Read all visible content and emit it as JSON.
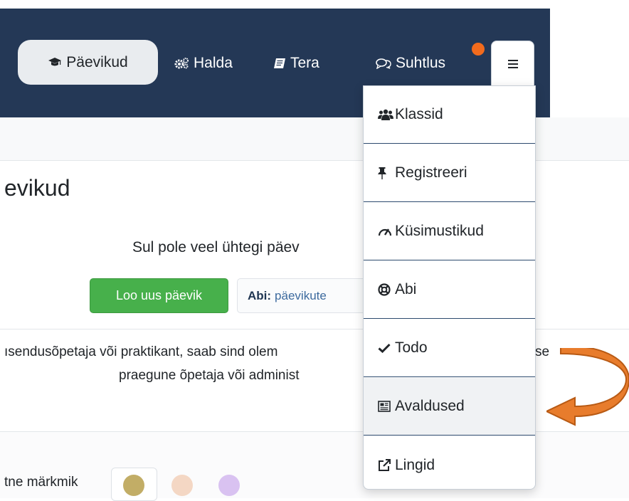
{
  "nav": {
    "items": [
      {
        "label": "Päevikud",
        "icon": "graduation-cap-icon"
      },
      {
        "label": "Halda",
        "icon": "gears-icon"
      },
      {
        "label": "Tera",
        "icon": "book-icon"
      },
      {
        "label": "Suhtlus",
        "icon": "comments-icon"
      }
    ],
    "menu_icon": "hamburger-icon",
    "colors": {
      "navbar": "#243856",
      "notification": "#f26b1d"
    }
  },
  "page": {
    "title": "evikud",
    "empty_message": "Sul pole veel ühtegi päev",
    "create_button": "Loo uus päevik",
    "help_label": "Abi:",
    "help_link": "päevikute",
    "info_line1": "ısendusõpetaja või praktikant, saab sind olem",
    "info_tail": "se",
    "info_line2": "praegune õpetaja või administ",
    "notebook_label": "tne märkmik",
    "swatch_colors": [
      "#c2ad66",
      "#f4d7c4",
      "#d9c2f1"
    ]
  },
  "dropdown": {
    "items": [
      {
        "label": "Klassid",
        "icon": "users-icon"
      },
      {
        "label": "Registreeri",
        "icon": "thumbtack-icon"
      },
      {
        "label": "Küsimustikud",
        "icon": "gauge-icon"
      },
      {
        "label": "Abi",
        "icon": "life-ring-icon"
      },
      {
        "label": "Todo",
        "icon": "check-icon"
      },
      {
        "label": "Avaldused",
        "icon": "newspaper-icon"
      },
      {
        "label": "Lingid",
        "icon": "external-link-icon"
      }
    ]
  },
  "annotation": {
    "arrow_color": "#e87c2c",
    "arrow_icon": "curved-arrow-icon"
  }
}
